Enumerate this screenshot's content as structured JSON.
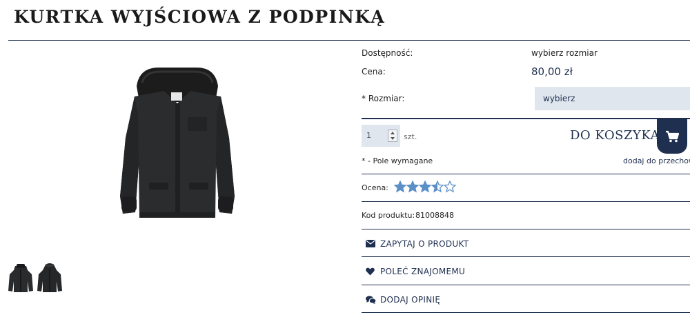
{
  "product": {
    "title": "KURTKA WYJŚCIOWA Z PODPINKĄ"
  },
  "details": {
    "availability_label": "Dostępność:",
    "availability_value": "wybierz rozmiar",
    "price_label": "Cena:",
    "price_value": "80,00 zł",
    "size_label": "* Rozmiar:",
    "size_selected": "wybierz",
    "quantity_value": "1",
    "quantity_unit": "szt.",
    "add_to_cart_label": "DO KOSZYKA",
    "required_note": "* - Pole wymagane",
    "store_link": "dodaj do przechowa",
    "rating_label": "Ocena:",
    "rating_value": 3.5,
    "rating_max": 5,
    "code_label": "Kod produktu:",
    "code_value": "81008848"
  },
  "actions": [
    {
      "label": "ZAPYTAJ O PRODUKT",
      "icon": "envelope-icon"
    },
    {
      "label": "POLEĆ ZNAJOMEMU",
      "icon": "heart-icon"
    },
    {
      "label": "DODAJ OPINIĘ",
      "icon": "chat-bubbles-icon"
    }
  ],
  "colors": {
    "accent": "#1e2f4f",
    "input_bg": "#dfe6ee",
    "star": "#5b8fc7"
  }
}
